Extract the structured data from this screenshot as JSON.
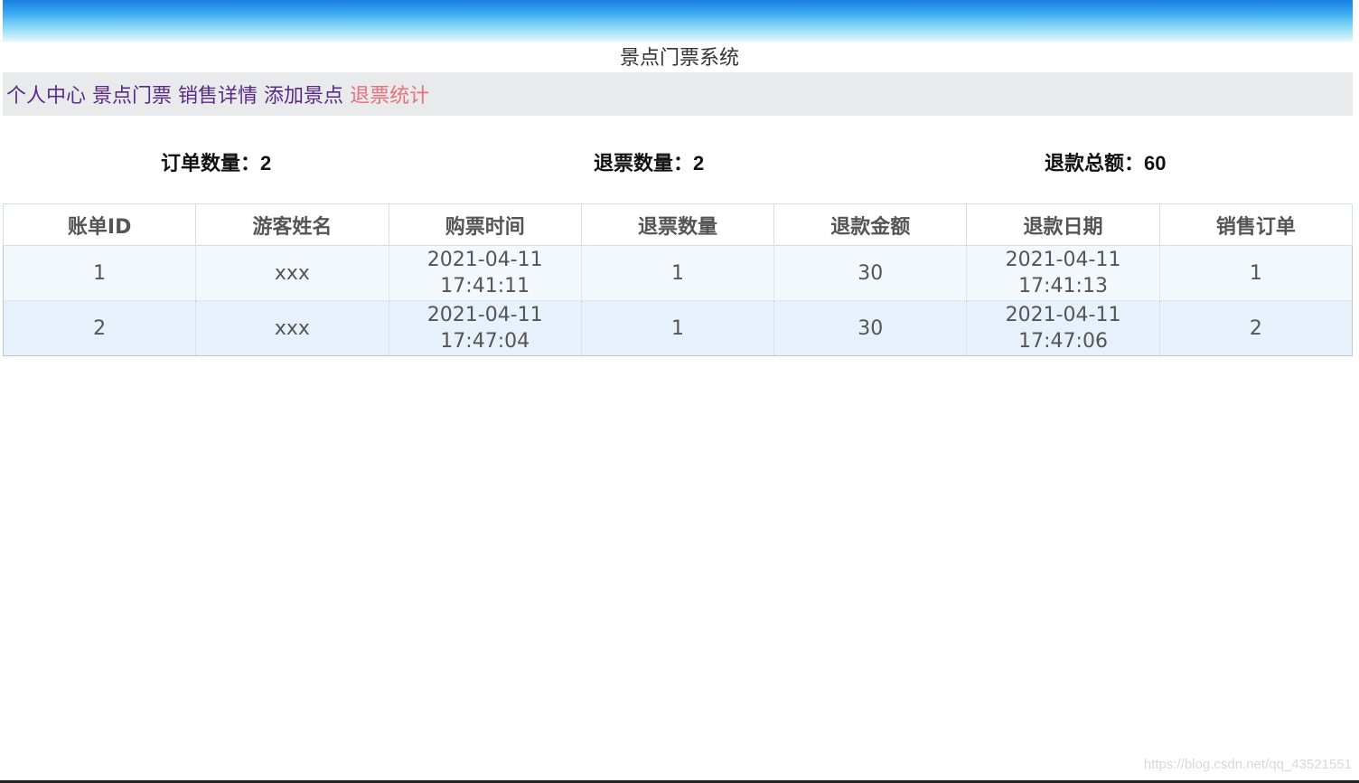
{
  "header": {
    "site_title": "景点门票系统"
  },
  "nav": {
    "items": [
      {
        "label": "个人中心"
      },
      {
        "label": "景点门票"
      },
      {
        "label": "销售详情"
      },
      {
        "label": "添加景点"
      },
      {
        "label": "退票统计"
      }
    ],
    "active": "退票统计"
  },
  "stats": {
    "order_count_label": "订单数量：",
    "order_count": "2",
    "refund_count_label": "退票数量：",
    "refund_count": "2",
    "refund_total_label": "退款总额：",
    "refund_total": "60"
  },
  "table": {
    "columns": [
      "账单ID",
      "游客姓名",
      "购票时间",
      "退票数量",
      "退款金额",
      "退款日期",
      "销售订单"
    ],
    "rows": [
      {
        "bill_id": "1",
        "name": "xxx",
        "purchase_date": "2021-04-11",
        "purchase_time": "17:41:11",
        "refund_qty": "1",
        "refund_amount": "30",
        "refund_date": "2021-04-11",
        "refund_time": "17:41:13",
        "sale_order": "1"
      },
      {
        "bill_id": "2",
        "name": "xxx",
        "purchase_date": "2021-04-11",
        "purchase_time": "17:47:04",
        "refund_qty": "1",
        "refund_amount": "30",
        "refund_date": "2021-04-11",
        "refund_time": "17:47:06",
        "sale_order": "2"
      }
    ]
  },
  "watermark": "https://blog.csdn.net/qq_43521551",
  "colors": {
    "nav_link": "#5b2a86",
    "nav_active": "#e8707a",
    "nav_background": "#e8eaec"
  }
}
